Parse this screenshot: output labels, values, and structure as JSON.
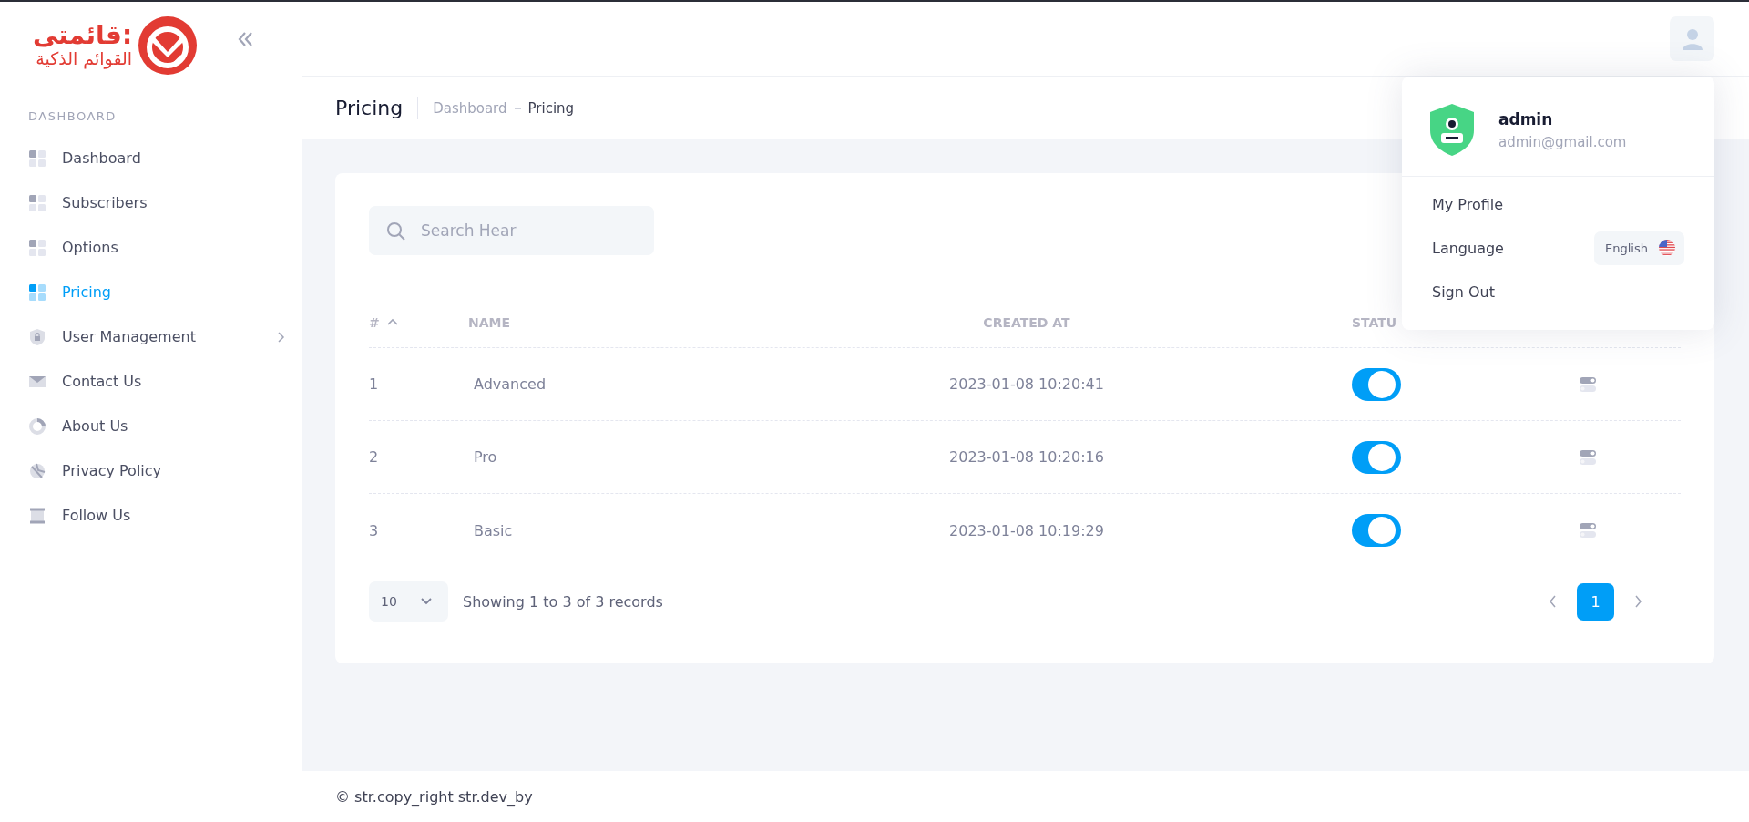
{
  "logo": {
    "title": "قائمتى:",
    "subtitle": "القوائم الذكية"
  },
  "sidebar": {
    "section": "DASHBOARD",
    "items": [
      {
        "label": "Dashboard",
        "selected": false
      },
      {
        "label": "Subscribers",
        "selected": false
      },
      {
        "label": "Options",
        "selected": false
      },
      {
        "label": "Pricing",
        "selected": true
      },
      {
        "label": "User Management",
        "selected": false,
        "has_submenu": true
      },
      {
        "label": "Contact Us",
        "selected": false
      },
      {
        "label": "About Us",
        "selected": false
      },
      {
        "label": "Privacy Policy",
        "selected": false
      },
      {
        "label": "Follow Us",
        "selected": false
      }
    ]
  },
  "page": {
    "title": "Pricing",
    "breadcrumb": [
      {
        "label": "Dashboard",
        "current": false
      },
      {
        "label": "Pricing",
        "current": true
      }
    ]
  },
  "search": {
    "placeholder": "Search Hear"
  },
  "table": {
    "columns": [
      {
        "label": "#",
        "sorted": true
      },
      {
        "label": "NAME"
      },
      {
        "label": "CREATED AT"
      },
      {
        "label": "STATU"
      }
    ],
    "rows": [
      {
        "id": "1",
        "name": "Advanced",
        "created_at": "2023-01-08 10:20:41",
        "on": true
      },
      {
        "id": "2",
        "name": "Pro",
        "created_at": "2023-01-08 10:20:16",
        "on": true
      },
      {
        "id": "3",
        "name": "Basic",
        "created_at": "2023-01-08 10:19:29",
        "on": true
      }
    ]
  },
  "pager": {
    "per_page": "10",
    "summary": "Showing 1 to 3 of 3 records",
    "pages": [
      {
        "label": "1",
        "selected": true
      }
    ]
  },
  "user_menu": {
    "name": "admin",
    "email": "admin@gmail.com",
    "items": [
      {
        "label": "My Profile"
      },
      {
        "label": "Language",
        "value": "English"
      },
      {
        "label": "Sign Out"
      }
    ]
  },
  "footer": {
    "text": "© str.copy_right str.dev_by"
  }
}
